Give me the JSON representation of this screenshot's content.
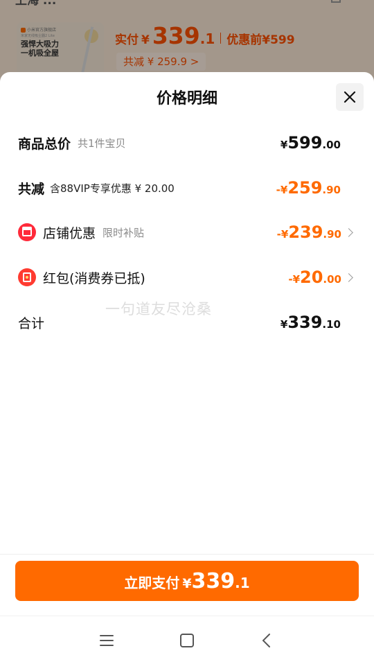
{
  "background": {
    "top_text": "上海 ...",
    "thumb": {
      "shop": "小米官方旗舰店",
      "sub": "米家无线吸尘器2 Lite",
      "slogan_line1": "强悍大吸力",
      "slogan_line2": "一机吸全屋"
    },
    "price": {
      "label": "实付",
      "currency": "¥",
      "int": "339",
      "dec": ".1",
      "before_label": "优惠前",
      "before_value": "¥599"
    },
    "discount_chip": "共减 ¥ 259.9 >"
  },
  "sheet": {
    "title": "价格明细",
    "watermark": "一句道友尽沧桑",
    "rows": {
      "total": {
        "label": "商品总价",
        "sub": "共1件宝贝",
        "sign": "¥",
        "int": "599",
        "dec": ".00"
      },
      "reduce": {
        "label": "共减",
        "sub": "含88VIP专享优惠 ¥ 20.00",
        "sign": "-¥",
        "int": "259",
        "dec": ".90"
      },
      "shop": {
        "label": "店铺优惠",
        "sub": "限时补贴",
        "sign": "-¥",
        "int": "239",
        "dec": ".90"
      },
      "packet": {
        "label": "红包(消费券已抵)",
        "sign": "-¥",
        "int": "20",
        "dec": ".00"
      },
      "sum": {
        "label": "合计",
        "sign": "¥",
        "int": "339",
        "dec": ".10"
      }
    }
  },
  "pay_button": {
    "label": "立即支付",
    "sign": "¥",
    "int": "339",
    "dec": ".1"
  },
  "colors": {
    "accent": "#ff6a00",
    "red_icon": "#ff2a3a"
  },
  "icons": {
    "close": "close-icon",
    "shop": "shop-icon",
    "packet": "red-packet-icon"
  }
}
